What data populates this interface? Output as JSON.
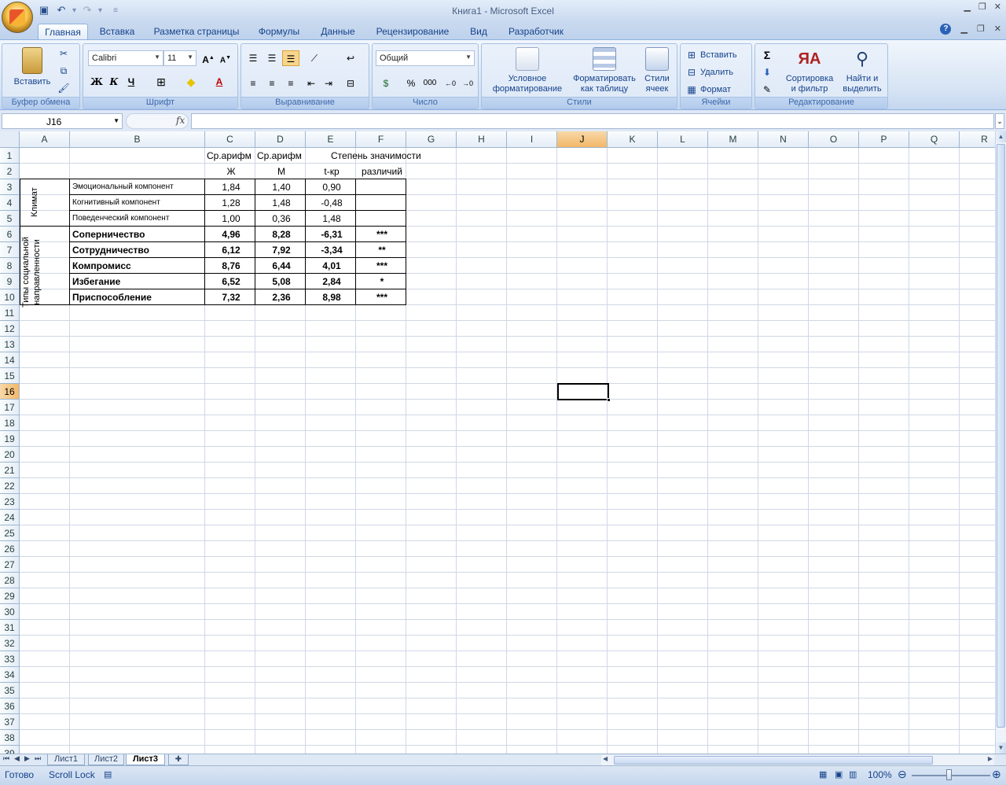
{
  "window": {
    "title": "Книга1 - Microsoft Excel",
    "controls": [
      "_",
      "▫",
      "✕"
    ],
    "doc_controls": [
      "_",
      "▫",
      "✕"
    ]
  },
  "quick_access": {
    "items": [
      "save-icon",
      "undo-icon",
      "redo-icon",
      "customize-icon"
    ]
  },
  "tabs": [
    {
      "label": "Главная",
      "active": true
    },
    {
      "label": "Вставка"
    },
    {
      "label": "Разметка страницы"
    },
    {
      "label": "Формулы"
    },
    {
      "label": "Данные"
    },
    {
      "label": "Рецензирование"
    },
    {
      "label": "Вид"
    },
    {
      "label": "Разработчик"
    }
  ],
  "ribbon": {
    "clipboard": {
      "label": "Буфер обмена",
      "paste": "Вставить"
    },
    "font": {
      "label": "Шрифт",
      "name": "Calibri",
      "size": "11",
      "bold": "Ж",
      "italic": "К",
      "underline": "Ч"
    },
    "alignment": {
      "label": "Выравнивание"
    },
    "number": {
      "label": "Число",
      "format": "Общий",
      "percent": "%",
      "thousands": "000"
    },
    "styles": {
      "label": "Стили",
      "conditional_1": "Условное",
      "conditional_2": "форматирование",
      "table_1": "Форматировать",
      "table_2": "как таблицу",
      "cell_1": "Стили",
      "cell_2": "ячеек"
    },
    "cells": {
      "label": "Ячейки",
      "insert": "Вставить",
      "delete": "Удалить",
      "format": "Формат"
    },
    "editing": {
      "label": "Редактирование",
      "sum": "Σ",
      "sort_1": "Сортировка",
      "sort_2": "и фильтр",
      "find_1": "Найти и",
      "find_2": "выделить"
    }
  },
  "formula_bar": {
    "name_box": "J16",
    "fx": "fx",
    "value": ""
  },
  "columns": [
    "A",
    "B",
    "C",
    "D",
    "E",
    "F",
    "G",
    "H",
    "I",
    "J",
    "K",
    "L",
    "M",
    "N",
    "O",
    "P",
    "Q",
    "R"
  ],
  "selected_column": "J",
  "rows": [
    "1",
    "2",
    "3",
    "4",
    "5",
    "6",
    "7",
    "8",
    "9",
    "10",
    "11",
    "12",
    "13",
    "14",
    "15",
    "16",
    "17",
    "18",
    "19",
    "20",
    "21",
    "22",
    "23",
    "24",
    "25",
    "26",
    "27",
    "28",
    "29",
    "30",
    "31",
    "32",
    "33",
    "34",
    "35",
    "36",
    "37",
    "38",
    "39"
  ],
  "selected_row": "16",
  "cells": {
    "C1": "Ср.арифм",
    "D1": "Ср.арифм",
    "E1": "Степень значимости",
    "C2": "Ж",
    "D2": "М",
    "E2": "t-кр",
    "F2": "различий",
    "A3": "Климат",
    "A6": "Типы социальной направленности",
    "table_rows": [
      {
        "b": "Эмоциональный компонент",
        "c": "1,84",
        "d": "1,40",
        "e": "0,90",
        "f": "",
        "bold": false
      },
      {
        "b": "Когнитивный компонент",
        "c": "1,28",
        "d": "1,48",
        "e": "-0,48",
        "f": "",
        "bold": false
      },
      {
        "b": "Поведенческий компонент",
        "c": "1,00",
        "d": "0,36",
        "e": "1,48",
        "f": "",
        "bold": false
      },
      {
        "b": "Соперничество",
        "c": "4,96",
        "d": "8,28",
        "e": "-6,31",
        "f": "***",
        "bold": true
      },
      {
        "b": "Сотрудничество",
        "c": "6,12",
        "d": "7,92",
        "e": "-3,34",
        "f": "**",
        "bold": true
      },
      {
        "b": "Компромисс",
        "c": "8,76",
        "d": "6,44",
        "e": "4,01",
        "f": "***",
        "bold": true
      },
      {
        "b": "Избегание",
        "c": "6,52",
        "d": "5,08",
        "e": "2,84",
        "f": "*",
        "bold": true
      },
      {
        "b": "Приспособление",
        "c": "7,32",
        "d": "2,36",
        "e": "8,98",
        "f": "***",
        "bold": true
      }
    ]
  },
  "sheet_tabs": [
    {
      "label": "Лист1"
    },
    {
      "label": "Лист2"
    },
    {
      "label": "Лист3",
      "active": true
    }
  ],
  "status": {
    "ready": "Готово",
    "scroll_lock": "Scroll Lock",
    "zoom": "100%"
  }
}
